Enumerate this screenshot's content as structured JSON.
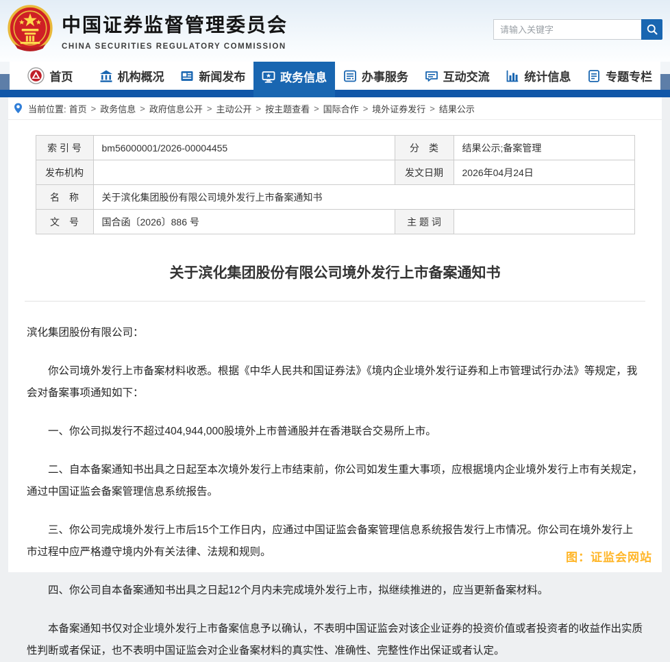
{
  "header": {
    "org_title_cn": "中国证券监督管理委员会",
    "org_title_en": "CHINA SECURITIES REGULATORY COMMISSION",
    "search_placeholder": "请输入关键字"
  },
  "nav": {
    "items": [
      {
        "label": "首页",
        "icon": "csrc-logo-icon",
        "active": false
      },
      {
        "label": "机构概况",
        "icon": "bank-icon",
        "active": false
      },
      {
        "label": "新闻发布",
        "icon": "news-icon",
        "active": false
      },
      {
        "label": "政务信息",
        "icon": "monitor-icon",
        "active": true
      },
      {
        "label": "办事服务",
        "icon": "form-icon",
        "active": false
      },
      {
        "label": "互动交流",
        "icon": "chat-icon",
        "active": false
      },
      {
        "label": "统计信息",
        "icon": "bar-chart-icon",
        "active": false
      },
      {
        "label": "专题专栏",
        "icon": "document-icon",
        "active": false
      }
    ]
  },
  "breadcrumb": {
    "prefix": "当前位置:",
    "separator": ">",
    "items": [
      "首页",
      "政务信息",
      "政府信息公开",
      "主动公开",
      "按主题查看",
      "国际合作",
      "境外证券发行",
      "结果公示"
    ]
  },
  "meta_table": {
    "rows": {
      "r1": {
        "l1": "索 引 号",
        "v1": "bm56000001/2026-00004455",
        "l2": "分　类",
        "v2": "结果公示;备案管理"
      },
      "r2": {
        "l1": "发布机构",
        "v1": "",
        "l2": "发文日期",
        "v2": "2026年04月24日"
      },
      "r3": {
        "l1": "名　称",
        "v1": "关于滨化集团股份有限公司境外发行上市备案通知书"
      },
      "r4": {
        "l1": "文　号",
        "v1": "国合函〔2026〕886 号",
        "l2": "主 题 词",
        "v2": ""
      }
    }
  },
  "document": {
    "title": "关于滨化集团股份有限公司境外发行上市备案通知书",
    "salutation": "滨化集团股份有限公司：",
    "paragraphs": [
      "你公司境外发行上市备案材料收悉。根据《中华人民共和国证券法》《境内企业境外发行证券和上市管理试行办法》等规定，我会对备案事项通知如下：",
      "一、你公司拟发行不超过404,944,000股境外上市普通股并在香港联合交易所上市。",
      "二、自本备案通知书出具之日起至本次境外发行上市结束前，你公司如发生重大事项，应根据境内企业境外发行上市有关规定，通过中国证监会备案管理信息系统报告。",
      "三、你公司完成境外发行上市后15个工作日内，应通过中国证监会备案管理信息系统报告发行上市情况。你公司在境外发行上市过程中应严格遵守境内外有关法律、法规和规则。",
      "四、你公司自本备案通知书出具之日起12个月内未完成境外发行上市，拟继续推进的，应当更新备案材料。",
      "本备案通知书仅对企业境外发行上市备案信息予以确认，不表明中国证监会对该企业证券的投资价值或者投资者的收益作出实质性判断或者保证，也不表明中国证监会对企业备案材料的真实性、准确性、完整性作出保证或者认定。"
    ]
  },
  "watermark": "图：证监会网站",
  "colors": {
    "accent_blue": "#1966b1",
    "nav_bar_blue": "#1157a8",
    "emblem_red": "#cf1f25",
    "emblem_gold": "#f0c24c",
    "watermark_orange": "#ffb629",
    "table_label_bg": "#f4f4f4",
    "table_border": "#cccccc"
  }
}
